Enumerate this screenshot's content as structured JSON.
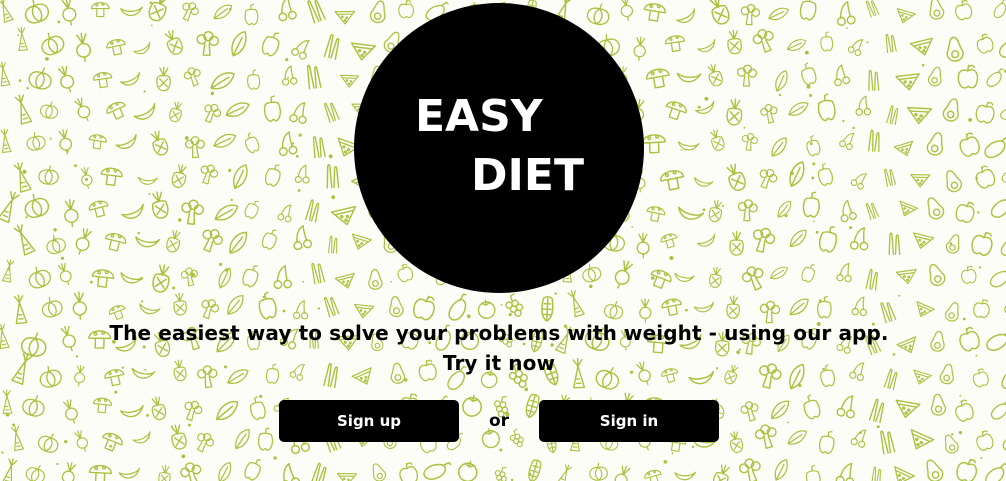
{
  "background": {
    "pattern_icon": "vegetable-doodle-pattern",
    "pattern_color": "#a9c23f",
    "base_color": "#fdfdf7"
  },
  "logo": {
    "line1": "EASY",
    "line2": "DIET",
    "circle_color": "#000000",
    "text_color": "#ffffff"
  },
  "hero": {
    "tagline_line1": "The easiest way to solve your problems with weight - using our app.",
    "tagline_line2": "Try it now"
  },
  "actions": {
    "signup_label": "Sign up",
    "separator": "or",
    "signin_label": "Sign in"
  }
}
